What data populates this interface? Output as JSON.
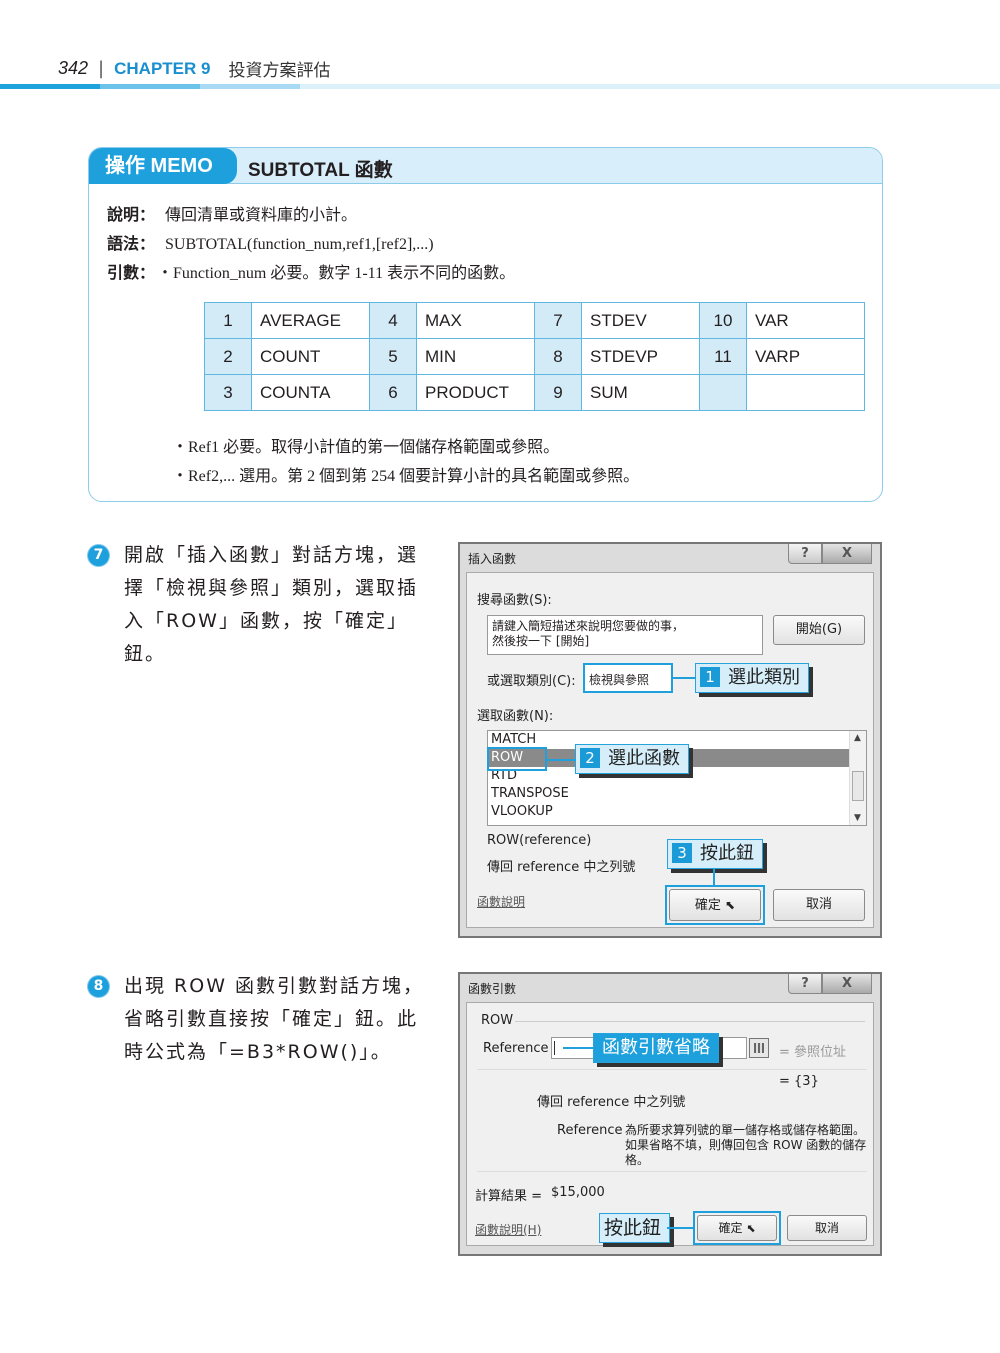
{
  "header": {
    "page_number": "342",
    "chapter": "CHAPTER 9",
    "chapter_title": "投資方案評估"
  },
  "memo": {
    "tag": "操作 MEMO",
    "title": "SUBTOTAL 函數",
    "desc_label": "說明：",
    "desc": "傳回清單或資料庫的小計。",
    "syntax_label": "語法：",
    "syntax": "SUBTOTAL(function_num,ref1,[ref2],...)",
    "args_label": "引數：",
    "arg1": "・Function_num 必要。數字 1-11 表示不同的函數。",
    "table": [
      [
        {
          "n": "1",
          "f": "AVERAGE"
        },
        {
          "n": "4",
          "f": "MAX"
        },
        {
          "n": "7",
          "f": "STDEV"
        },
        {
          "n": "10",
          "f": "VAR"
        }
      ],
      [
        {
          "n": "2",
          "f": "COUNT"
        },
        {
          "n": "5",
          "f": "MIN"
        },
        {
          "n": "8",
          "f": "STDEVP"
        },
        {
          "n": "11",
          "f": "VARP"
        }
      ],
      [
        {
          "n": "3",
          "f": "COUNTA"
        },
        {
          "n": "6",
          "f": "PRODUCT"
        },
        {
          "n": "9",
          "f": "SUM"
        },
        {
          "n": "",
          "f": ""
        }
      ]
    ],
    "arg2": "・Ref1 必要。取得小計值的第一個儲存格範圍或參照。",
    "arg3": "・Ref2,... 選用。第 2 個到第 254 個要計算小計的具名範圍或參照。"
  },
  "step7": {
    "number": "7",
    "lines": [
      "開啟「插入函數」對話方塊，選",
      "擇「檢視與參照」類別，選取插",
      "入「ROW」函數，按「確定」",
      "鈕。"
    ]
  },
  "step8": {
    "number": "8",
    "lines": [
      "出現 ROW 函數引數對話方塊，",
      "省略引數直接按「確定」鈕。此",
      "時公式為「=B3*ROW()」。"
    ]
  },
  "dialog1": {
    "title": "插入函數",
    "help_btn": "?",
    "close_btn": "X",
    "search_label": "搜尋函數(S):",
    "search_placeholder_1": "請鍵入簡短描述來說明您要做的事，",
    "search_placeholder_2": "然後按一下 [開始]",
    "go_button": "開始(G)",
    "category_label": "或選取類別(C):",
    "category_value": "檢視與參照",
    "select_label": "選取函數(N):",
    "functions": [
      "MATCH",
      "ROW",
      "RTD",
      "TRANSPOSE",
      "VLOOKUP"
    ],
    "selected_function": "ROW",
    "signature": "ROW(reference)",
    "description": "傳回 reference 中之列號",
    "help_link": "函數說明",
    "ok_button": "確定",
    "cancel_button": "取消",
    "callout1_num": "1",
    "callout1": "選此類別",
    "callout2_num": "2",
    "callout2": "選此函數",
    "callout3_num": "3",
    "callout3": "按此鈕"
  },
  "dialog2": {
    "title": "函數引數",
    "help_btn": "?",
    "close_btn": "X",
    "func_name": "ROW",
    "arg_label": "Reference",
    "arg_value": "",
    "arg_hint": "= 參照位址",
    "result_inline": "= {3}",
    "description": "傳回 reference 中之列號",
    "arg_desc_label": "Reference",
    "arg_desc_1": "為所要求算列號的單一儲存格或儲存格範圍。",
    "arg_desc_2": "如果省略不填，則傳回包含 ROW 函數的儲存",
    "arg_desc_3": "格。",
    "result_label": "計算結果 =",
    "result_value": "$15,000",
    "help_link": "函數說明(H)",
    "ok_button": "確定",
    "cancel_button": "取消",
    "callout_arg": "函數引數省略",
    "callout_ok": "按此鈕"
  }
}
